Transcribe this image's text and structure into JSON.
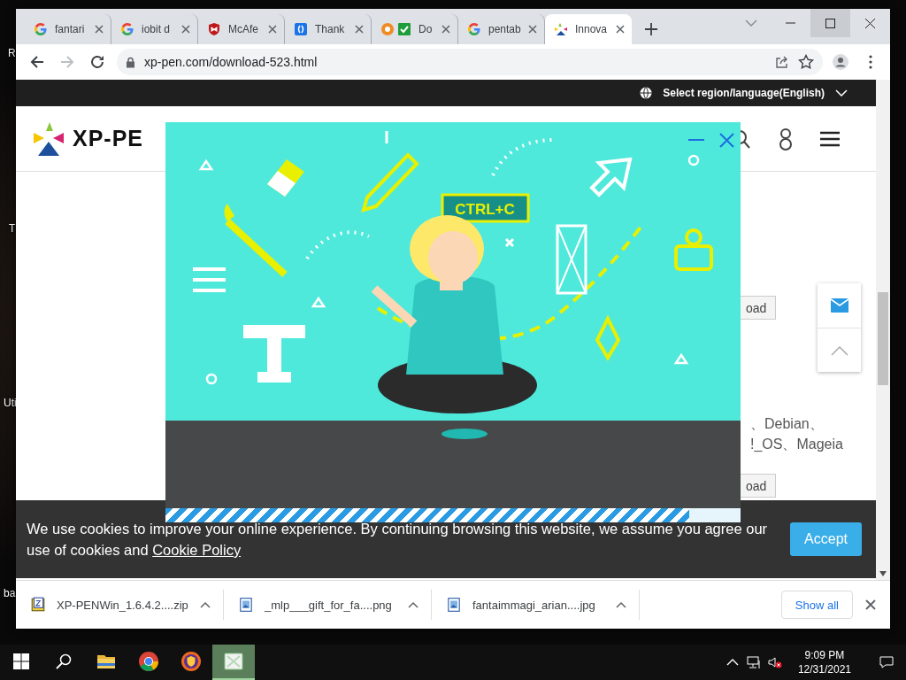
{
  "desktop": {
    "labels": [
      "R",
      "T",
      "Uti",
      "ba"
    ]
  },
  "browser": {
    "tabs": [
      {
        "title": "fantari",
        "kind": "google",
        "selected": false
      },
      {
        "title": "iobit d",
        "kind": "google",
        "selected": false
      },
      {
        "title": "McAfe",
        "kind": "mcafee",
        "selected": false
      },
      {
        "title": "Thank",
        "kind": "bluebox",
        "selected": false
      },
      {
        "title": "Do",
        "kind": "pair",
        "selected": false
      },
      {
        "title": "pentab",
        "kind": "google",
        "selected": false
      },
      {
        "title": "Innova",
        "kind": "xppen",
        "selected": true
      }
    ],
    "url": "xp-pen.com/download-523.html"
  },
  "page": {
    "region_selector": "Select region/language(English)",
    "logo": "XP-PE",
    "download_buttons": [
      "oad",
      "oad"
    ],
    "text_lines": [
      "、Debian、",
      "!_OS、Mageia"
    ]
  },
  "modal": {
    "bubble_text": "CTRL+C",
    "progress": {
      "level": 0.91
    }
  },
  "cookie_banner": {
    "text": "We use cookies to improve your online experience. By continuing browsing this website, we assume you agree our use of cookies and ",
    "link": "Cookie Policy",
    "button": "Accept"
  },
  "downloads": {
    "items": [
      {
        "name": "XP-PENWin_1.6.4.2....zip",
        "kind": "zip"
      },
      {
        "name": "_mlp___gift_for_fa....png",
        "kind": "image"
      },
      {
        "name": "fantaimmagi_arian....jpg",
        "kind": "image"
      }
    ],
    "show_all": "Show all"
  },
  "taskbar": {
    "apps": [
      {
        "kind": "folder",
        "selected": false
      },
      {
        "kind": "chrome",
        "selected": false
      },
      {
        "kind": "shield",
        "selected": false
      },
      {
        "kind": "app",
        "selected": true
      }
    ],
    "time": "9:09 PM",
    "date": "12/31/2021"
  }
}
